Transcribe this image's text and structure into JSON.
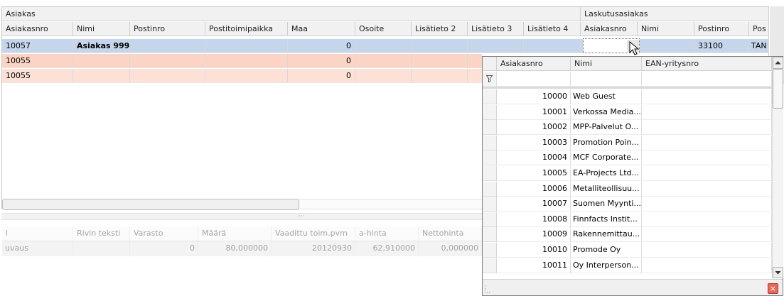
{
  "groups": {
    "asiakas": "Asiakas",
    "laskutus": "Laskutusasiakas"
  },
  "columns": {
    "asiakasnro": "Asiakasnro",
    "nimi": "Nimi",
    "postinro": "Postinro",
    "postitoimipaikka": "Postitoimipaikka",
    "maa": "Maa",
    "osoite": "Osoite",
    "lisatieto2": "Lisätieto 2",
    "lisatieto3": "Lisätieto 3",
    "lisatieto4": "Lisätieto 4",
    "l_asiakasnro": "Asiakasnro",
    "l_nimi": "Nimi",
    "l_postinro": "Postinro",
    "l_pos": "Pos"
  },
  "rows": [
    {
      "asiakasnro": "10057",
      "nimi": "Asiakas 999...",
      "maa_value": "0",
      "l_postinro": "33100",
      "l_pos": "TAN"
    },
    {
      "asiakasnro": "10055",
      "maa_value": "0"
    },
    {
      "asiakasnro": "10055",
      "maa_value": "0"
    }
  ],
  "lower_grid": {
    "headers": [
      "l",
      "Rivin teksti",
      "Varasto",
      "Määrä",
      "Vaadittu toim.pvm",
      "a-hinta",
      "Nettohinta"
    ],
    "row": [
      "uvaus",
      "",
      "0",
      "80,000000",
      "20120930",
      "62,910000",
      "0,000000"
    ]
  },
  "popup": {
    "columns": {
      "asiakasnro": "Asiakasnro",
      "nimi": "Nimi",
      "ean": "EAN-yritysnro"
    },
    "filter_icon": "filter-icon",
    "items": [
      {
        "nro": "10000",
        "nimi": "Web Guest"
      },
      {
        "nro": "10001",
        "nimi": "Verkossa Media..."
      },
      {
        "nro": "10002",
        "nimi": "MPP-Palvelut O..."
      },
      {
        "nro": "10003",
        "nimi": "Promotion Poin..."
      },
      {
        "nro": "10004",
        "nimi": "MCF Corporate..."
      },
      {
        "nro": "10005",
        "nimi": "EA-Projects Ltd..."
      },
      {
        "nro": "10006",
        "nimi": "Metalliteollisuu..."
      },
      {
        "nro": "10007",
        "nimi": "Suomen Myynti..."
      },
      {
        "nro": "10008",
        "nimi": "Finnfacts Instit..."
      },
      {
        "nro": "10009",
        "nimi": "Rakennemittau..."
      },
      {
        "nro": "10010",
        "nimi": "Promode Oy"
      },
      {
        "nro": "10011",
        "nimi": "Oy Interperson..."
      }
    ],
    "close_icon": "close-icon"
  },
  "colors": {
    "selected_row": "#c5d5eb",
    "row_salmon": "#fbd4c6",
    "row_salmon_light": "#fde1d6",
    "close_red": "#e46a5a"
  }
}
